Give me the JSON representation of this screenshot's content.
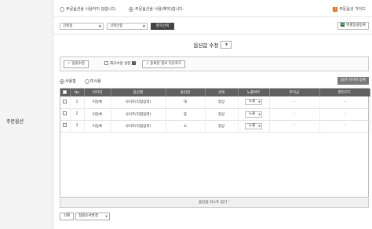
{
  "sidebar_label": "주문옵션",
  "top": {
    "radio_off": "주문옵션을 사용하지 않습니다.",
    "radio_on": "주문옵션을 사용(해야)합니다.",
    "guide_icon": "i",
    "guide_link": "주문옵션 가이드"
  },
  "filter": {
    "select1": "선택형",
    "select2": "선택안함",
    "apply_button": "항목선택",
    "excel_icon": "X",
    "excel_button": "엑셀일괄등록"
  },
  "section": {
    "title": "옵션값 수정"
  },
  "toolbar": {
    "bulk_edit": "일괄수정",
    "stock_setting_label": "재고수량 설정",
    "help_mark": "?",
    "download_button": "등록된 정보 다운로드"
  },
  "usage": {
    "used": "사용함",
    "unused": "미사용",
    "image_register": "옵션 이미지 등록"
  },
  "table": {
    "headers": [
      "",
      "No",
      "이미지",
      "옵션명",
      "옵션값",
      "상태",
      "노출여부",
      "추가금",
      "판타코드"
    ],
    "rows": [
      {
        "no": "1",
        "image": "이등록",
        "name": "사이즈(직접입력)",
        "value": "대",
        "status": "정상",
        "display": "노출",
        "extra": "-",
        "code": "-"
      },
      {
        "no": "2",
        "image": "이등록",
        "name": "사이즈(직접입력)",
        "value": "중",
        "status": "정상",
        "display": "노출",
        "extra": "-",
        "code": "-"
      },
      {
        "no": "3",
        "image": "이등록",
        "name": "사이즈(직접입력)",
        "value": "소",
        "status": "정상",
        "display": "노출",
        "extra": "-",
        "code": "-"
      }
    ]
  },
  "list_close": "옵션값 리스트 접기 ˅",
  "bottom": {
    "delete_button": "삭제",
    "order_select": "정렬순서변경"
  },
  "colors": {
    "header_bg": "#606060",
    "radio_on": "#2b5bb5",
    "guide_icon": "#e87722",
    "excel_icon": "#1e7e34"
  }
}
